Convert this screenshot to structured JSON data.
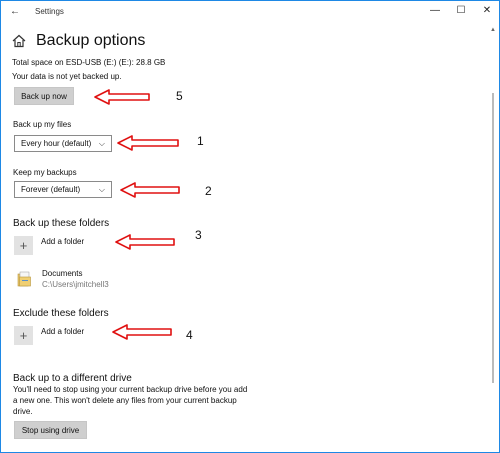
{
  "titlebar": {
    "back_glyph": "←",
    "title": "Settings",
    "minimize_glyph": "—",
    "maximize_glyph": "☐",
    "close_glyph": "✕"
  },
  "page": {
    "title": "Backup options",
    "total_space": "Total space on ESD-USB (E:) (E:): 28.8 GB",
    "status": "Your data is not yet backed up.",
    "backup_now_label": "Back up now"
  },
  "backup_frequency": {
    "label": "Back up my files",
    "selected": "Every hour (default)"
  },
  "keep_backups": {
    "label": "Keep my backups",
    "selected": "Forever (default)"
  },
  "backup_folders": {
    "heading": "Back up these folders",
    "add_label": "Add a folder",
    "plus_glyph": "+",
    "items": [
      {
        "name": "Documents",
        "path": "C:\\Users\\jmitchell3"
      }
    ]
  },
  "exclude_folders": {
    "heading": "Exclude these folders",
    "add_label": "Add a folder",
    "plus_glyph": "+"
  },
  "different_drive": {
    "heading": "Back up to a different drive",
    "description_line1": "You'll need to stop using your current backup drive before you add",
    "description_line2": "a new one. This won't delete any files from your current backup",
    "description_line3": "drive.",
    "stop_button_label": "Stop using drive"
  },
  "annotations": {
    "color": "#e01010",
    "numbers": [
      "5",
      "1",
      "2",
      "3",
      "4"
    ]
  },
  "icons": {
    "home": "home-icon",
    "folder": "folder-icon",
    "dropdown": "chevron-down-icon",
    "plus": "plus-icon"
  }
}
